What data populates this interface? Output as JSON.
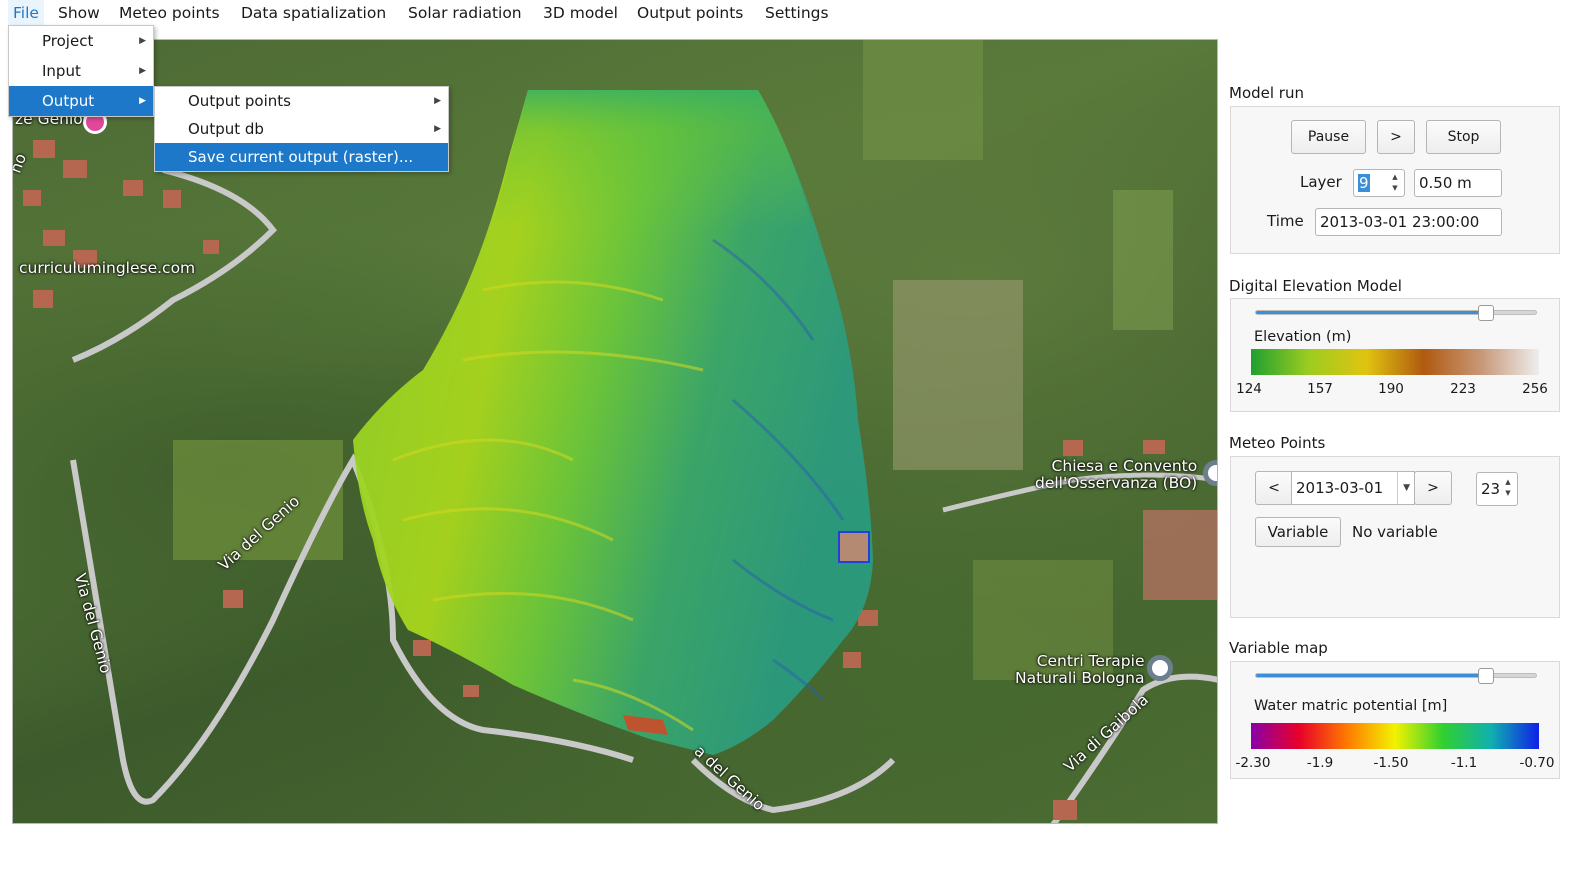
{
  "menubar": {
    "items": [
      "File",
      "Show",
      "Meteo points",
      "Data spatialization",
      "Solar radiation",
      "3D model",
      "Output points",
      "Settings"
    ],
    "active": "File"
  },
  "file_menu": {
    "items": [
      {
        "label": "Project",
        "submenu": true
      },
      {
        "label": "Input",
        "submenu": true
      },
      {
        "label": "Output",
        "submenu": true,
        "selected": true
      }
    ]
  },
  "output_submenu": {
    "items": [
      {
        "label": "Output points",
        "submenu": true
      },
      {
        "label": "Output db",
        "submenu": true
      },
      {
        "label": "Save current output (raster)...",
        "submenu": false,
        "selected": true
      }
    ]
  },
  "map": {
    "labels": {
      "genio_top": "ze Genio",
      "ho": "ho",
      "curriculum": "curriculuminglese.com",
      "via_genio_1": "Via del Genio",
      "via_genio_2": "Via del Genio",
      "via_genio_3": "a del Genio",
      "chiesa": "Chiesa e Convento\ndell'Osservanza (BO)",
      "centri": "Centri Terapie\nNaturali Bologna",
      "via_gaibola": "Via di Gaibola"
    }
  },
  "model_run": {
    "title": "Model run",
    "pause_label": "Pause",
    "next_label": ">",
    "stop_label": "Stop",
    "layer_label": "Layer",
    "layer_value": "9",
    "layer_depth": "0.50 m",
    "time_label": "Time",
    "time_value": "2013-03-01 23:00:00"
  },
  "dem": {
    "title": "Digital Elevation Model",
    "slider_level": 0.82,
    "legend_title": "Elevation (m)",
    "ticks": [
      "124",
      "157",
      "190",
      "223",
      "256"
    ],
    "colors": [
      "#20a030",
      "#9ccc20",
      "#e0c410",
      "#b05a10",
      "#c89878",
      "#eeeeee"
    ]
  },
  "meteo": {
    "title": "Meteo Points",
    "prev_label": "<",
    "date_value": "2013-03-01",
    "next_label": ">",
    "hour_value": "23",
    "variable_button": "Variable",
    "variable_status": "No variable"
  },
  "variable_map": {
    "title": "Variable map",
    "slider_level": 0.82,
    "legend_title": "Water matric potential [m]",
    "ticks": [
      "-2.30",
      "-1.9",
      "-1.50",
      "-1.1",
      "-0.70"
    ],
    "colors": [
      "#8a00a8",
      "#e8002a",
      "#ff7a00",
      "#f2f200",
      "#30d030",
      "#10b0b0",
      "#1020e8"
    ]
  }
}
